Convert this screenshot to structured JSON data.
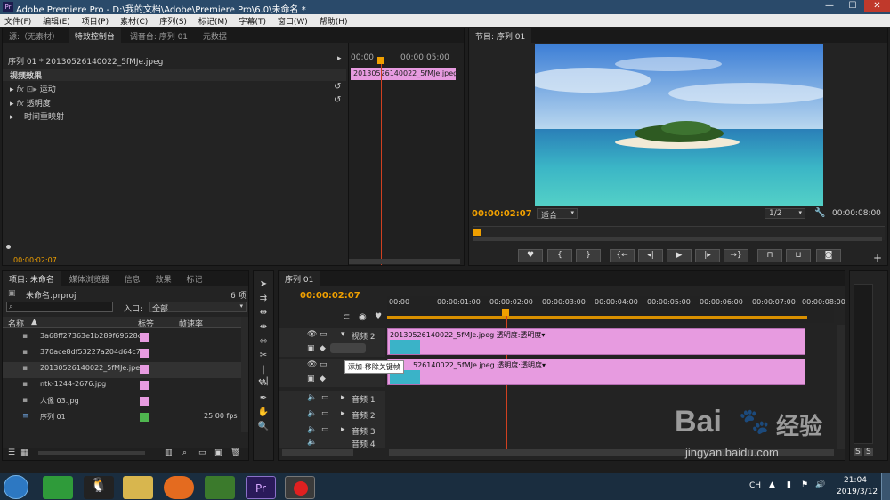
{
  "window": {
    "title": "Adobe Premiere Pro - D:\\我的文档\\Adobe\\Premiere Pro\\6.0\\未命名 *",
    "min": "—",
    "max": "☐",
    "close": "✕"
  },
  "menu": [
    "文件(F)",
    "编辑(E)",
    "项目(P)",
    "素材(C)",
    "序列(S)",
    "标记(M)",
    "字幕(T)",
    "窗口(W)",
    "帮助(H)"
  ],
  "top_tabs": [
    "源:（无素材）",
    "特效控制台",
    "调音台: 序列 01",
    "元数据"
  ],
  "effects": {
    "clip": "序列 01 * 20130526140022_5fMJe.jpeg",
    "section": "视频效果",
    "items": [
      "运动",
      "透明度",
      "时间重映射"
    ],
    "time_start": "00:00",
    "time_end": "00:00:05:00",
    "clip_label": "20130526140022_5fMJe.jpeg",
    "timecode": "00:00:02:07"
  },
  "program": {
    "tab": "节目: 序列 01",
    "timecode": "00:00:02:07",
    "fit": "适合",
    "quality": "1/2",
    "duration": "00:00:08:00"
  },
  "project": {
    "tabs": [
      "项目: 未命名",
      "媒体浏览器",
      "信息",
      "效果",
      "标记"
    ],
    "name": "未命名.prproj",
    "count": "6 项",
    "entry_label": "入口:",
    "entry_value": "全部",
    "col_name": "名称",
    "col_label": "标签",
    "col_rate": "帧速率",
    "items": [
      {
        "name": "3a68ff27363e1b289f69628c",
        "rate": ""
      },
      {
        "name": "370ace8df53227a204d64c7",
        "rate": ""
      },
      {
        "name": "20130526140022_5fMJe.jpe",
        "rate": ""
      },
      {
        "name": "ntk-1244-2676.jpg",
        "rate": ""
      },
      {
        "name": "人像 03.jpg",
        "rate": ""
      },
      {
        "name": "序列 01",
        "rate": "25.00 fps"
      }
    ]
  },
  "timeline": {
    "tab": "序列 01",
    "timecode": "00:00:02:07",
    "ruler": [
      "00:00",
      "00:00:01:00",
      "00:00:02:00",
      "00:00:03:00",
      "00:00:04:00",
      "00:00:05:00",
      "00:00:06:00",
      "00:00:07:00",
      "00:00:08:00"
    ],
    "video_tracks": [
      {
        "name": "视频 2",
        "clip": "20130526140022_5fMJe.jpeg  透明度:透明度▾"
      },
      {
        "name": "",
        "clip": "526140022_5fMJe.jpeg  透明度:透明度▾"
      }
    ],
    "audio_tracks": [
      "音频 1",
      "音频 2",
      "音频 3",
      "音频 4"
    ],
    "tooltip": "添加-移除关键帧"
  },
  "meter": {
    "s1": "S",
    "s2": "S"
  },
  "watermark": {
    "brand": "Bai",
    "brand2": "经验",
    "url": "jingyan.baidu.com"
  },
  "taskbar": {
    "time": "21:04",
    "date": "2019/3/12",
    "lang": "CH"
  }
}
